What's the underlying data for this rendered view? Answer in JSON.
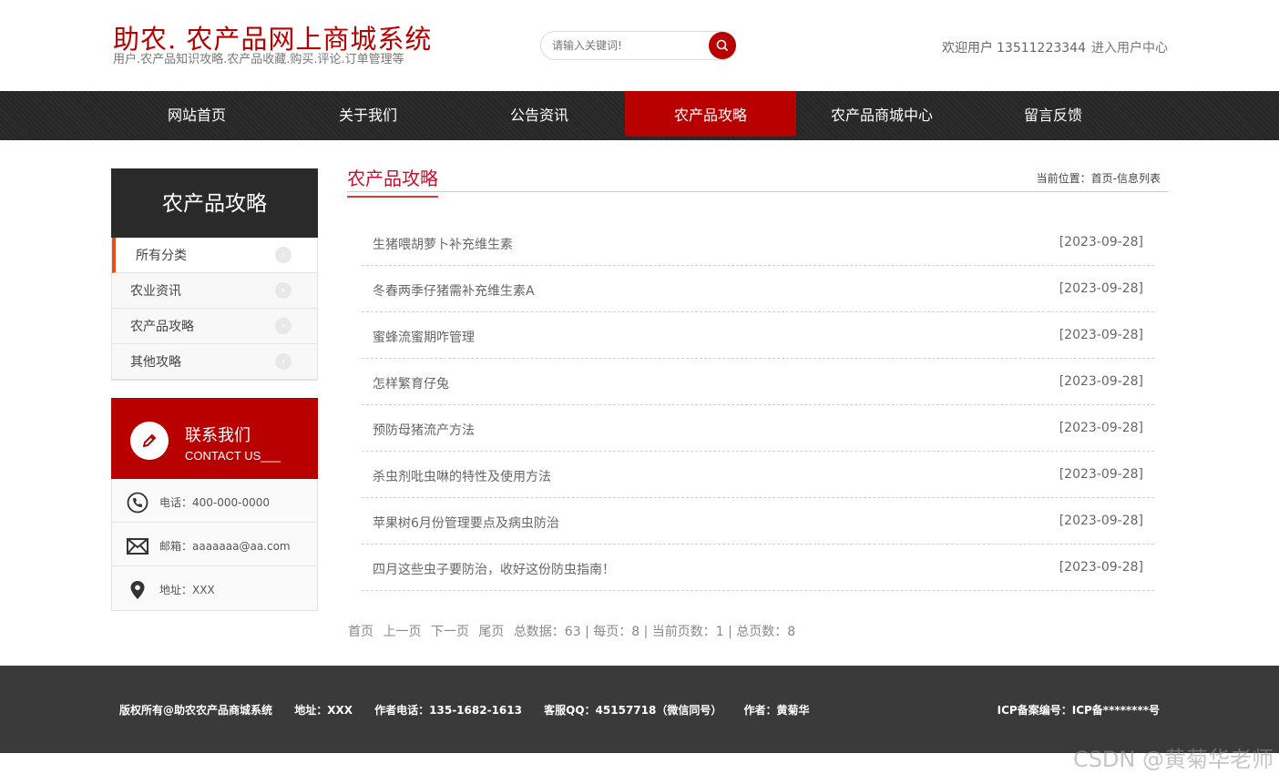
{
  "header": {
    "site_title": "助农. 农产品网上商城系统",
    "site_subtitle": "用户.农产品知识攻略.农产品收藏.购买.评论.订单管理等",
    "search_placeholder": "请输入关键词!",
    "welcome": "欢迎用户",
    "username": "13511223344",
    "user_center": "进入用户中心"
  },
  "nav": {
    "items": [
      {
        "label": "网站首页"
      },
      {
        "label": "关于我们"
      },
      {
        "label": "公告资讯"
      },
      {
        "label": "农产品攻略",
        "active": true
      },
      {
        "label": "农产品商城中心"
      },
      {
        "label": "留言反馈"
      }
    ]
  },
  "sidebar": {
    "title": "农产品攻略",
    "items": [
      {
        "label": "所有分类",
        "active": true
      },
      {
        "label": "农业资讯"
      },
      {
        "label": "农产品攻略"
      },
      {
        "label": "其他攻略"
      }
    ],
    "arrow": "›",
    "contact": {
      "title": "联系我们",
      "subtitle": "CONTACT US___",
      "phone": "电话：400-000-0000",
      "email": "邮箱：aaaaaaa@aa.com",
      "address": "地址：XXX"
    }
  },
  "main": {
    "title": "农产品攻略",
    "breadcrumb": "当前位置：首页-信息列表",
    "articles": [
      {
        "title": "生猪喂胡萝卜补充维生素",
        "date": "[2023-09-28]"
      },
      {
        "title": "冬春两季仔猪需补充维生素A",
        "date": "[2023-09-28]"
      },
      {
        "title": "蜜蜂流蜜期咋管理",
        "date": "[2023-09-28]"
      },
      {
        "title": "怎样繁育仔兔",
        "date": "[2023-09-28]"
      },
      {
        "title": "预防母猪流产方法",
        "date": "[2023-09-28]"
      },
      {
        "title": "杀虫剂吡虫啉的特性及使用方法",
        "date": "[2023-09-28]"
      },
      {
        "title": "苹果树6月份管理要点及病虫防治",
        "date": "[2023-09-28]"
      },
      {
        "title": "四月这些虫子要防治，收好这份防虫指南！",
        "date": "[2023-09-28]"
      }
    ],
    "pager": {
      "first": "首页",
      "prev": "上一页",
      "next": "下一页",
      "last": "尾页",
      "summary": "总数据：63 | 每页：8 | 当前页数：1 | 总页数：8"
    }
  },
  "footer": {
    "copyright": "版权所有@助农农产品商城系统",
    "address": "地址：XXX",
    "author_phone": "作者电话：135-1682-1613",
    "service_qq": "客服QQ：45157718（微信同号）",
    "author": "作者：黄菊华",
    "icp": "ICP备案编号：ICP备********号"
  },
  "watermark": "CSDN @黄菊华老师",
  "colors": {
    "brand_red": "#b80000",
    "nav_bg": "#2a2a2a",
    "footer_bg": "#3a3a3a",
    "accent_orange": "#e8501a"
  }
}
